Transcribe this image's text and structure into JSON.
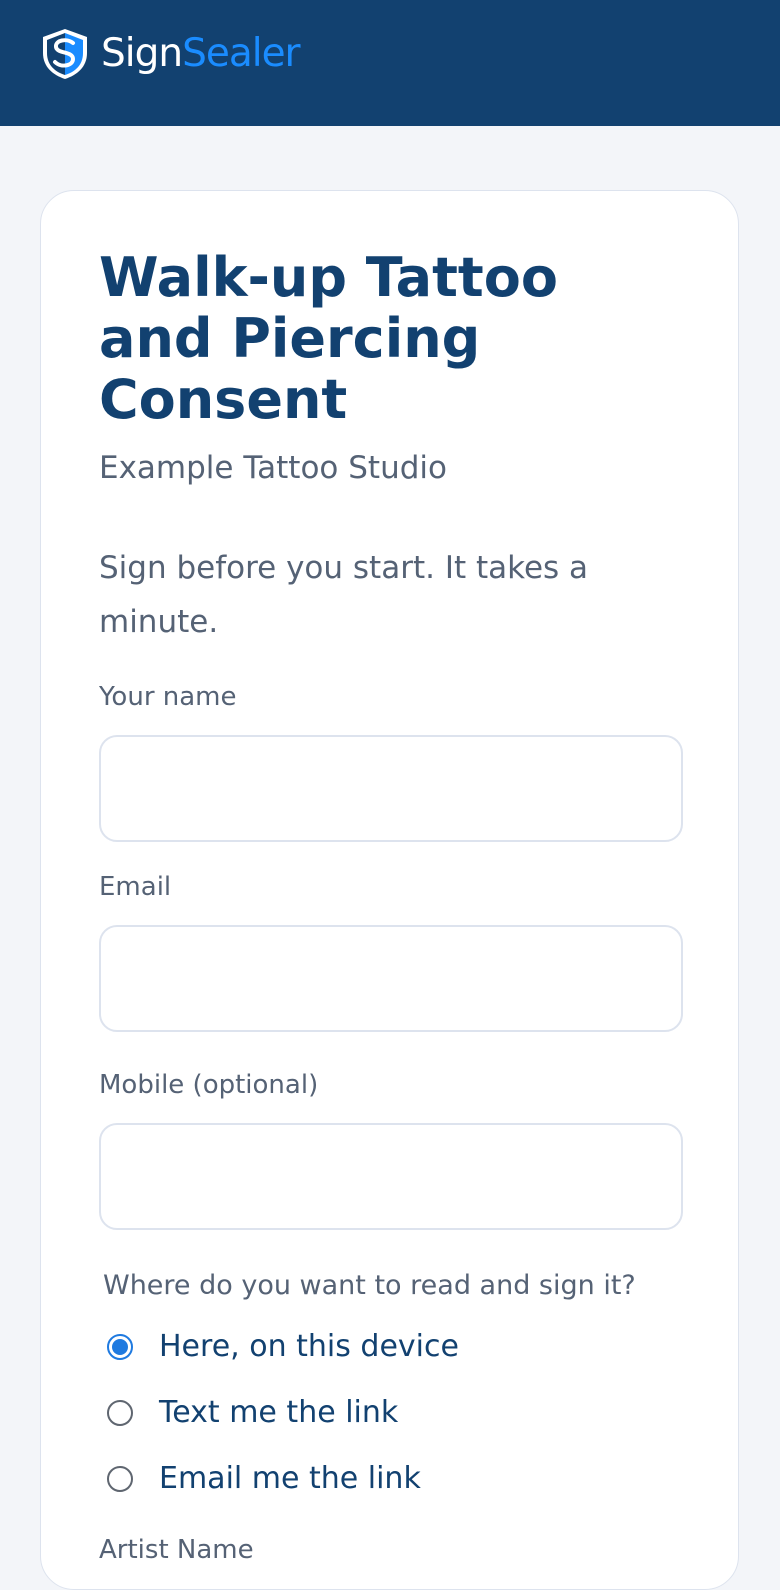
{
  "brand": {
    "name_part1": "Sign",
    "name_part2": "Sealer",
    "logo_icon": "shield-s-icon",
    "colors": {
      "header_bg": "#124170",
      "accent": "#1a8cff"
    }
  },
  "form": {
    "title": "Walk-up Tattoo and Piercing Consent",
    "subtitle": "Example Tattoo Studio",
    "intro": "Sign before you start. It takes a minute.",
    "fields": {
      "name": {
        "label": "Your name",
        "value": "",
        "placeholder": ""
      },
      "email": {
        "label": "Email",
        "value": "",
        "placeholder": ""
      },
      "mobile": {
        "label": "Mobile (optional)",
        "value": "",
        "placeholder": ""
      }
    },
    "delivery": {
      "question": "Where do you want to read and sign it?",
      "options": [
        {
          "label": "Here, on this device",
          "selected": true
        },
        {
          "label": "Text me the link",
          "selected": false
        },
        {
          "label": "Email me the link",
          "selected": false
        }
      ]
    },
    "next_label": "Artist Name"
  }
}
